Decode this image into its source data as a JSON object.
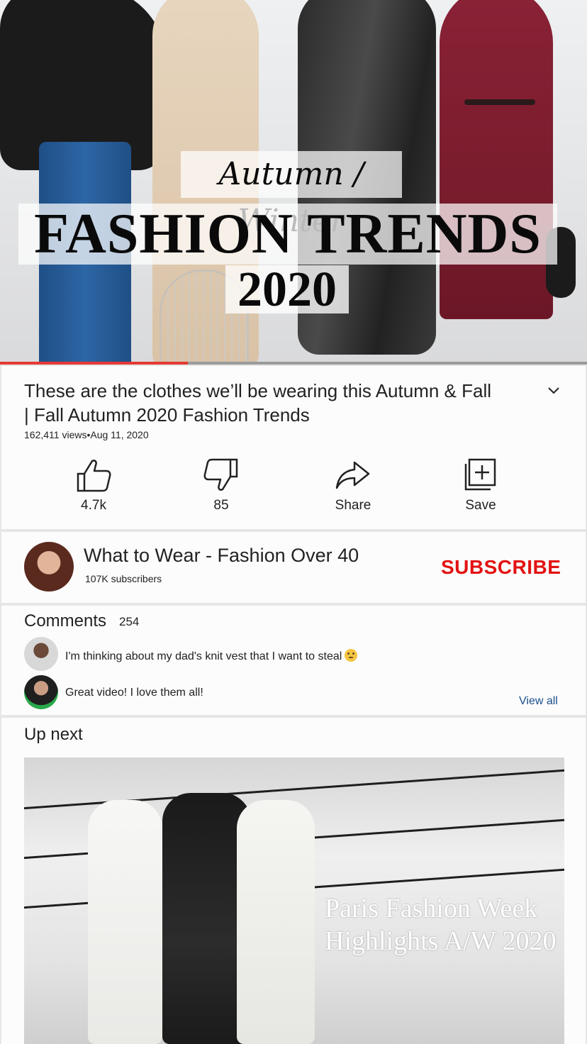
{
  "player": {
    "thumbnail": {
      "script_line": "Autumn / Winter",
      "headline": "FASHION TRENDS",
      "year": "2020"
    },
    "progress_fraction": 0.32
  },
  "video": {
    "title": "These are the clothes we’ll be wearing this Autumn & Fall | Fall Autumn 2020 Fashion Trends",
    "views": "162,411 views",
    "date": "Aug 11, 2020",
    "separator": "•"
  },
  "actions": {
    "like": "4.7k",
    "dislike": "85",
    "share": "Share",
    "save": "Save"
  },
  "channel": {
    "name": "What to Wear - Fashion Over 40",
    "subscribers": "107K subscribers",
    "subscribe_label": "SUBSCRIBE"
  },
  "comments": {
    "heading": "Comments",
    "count": "254",
    "items": [
      {
        "text": "I'm thinking about my dad's knit vest that I want to steal"
      },
      {
        "text": "Great video! I love them all!"
      }
    ],
    "view_all": "View all"
  },
  "up_next": {
    "heading": "Up next",
    "thumbnail_title": "Paris Fashion Week Highlights A/W 2020"
  },
  "colors": {
    "accent_red": "#e31212",
    "progress_red": "#e53935",
    "link_blue": "#1a4f8a"
  }
}
